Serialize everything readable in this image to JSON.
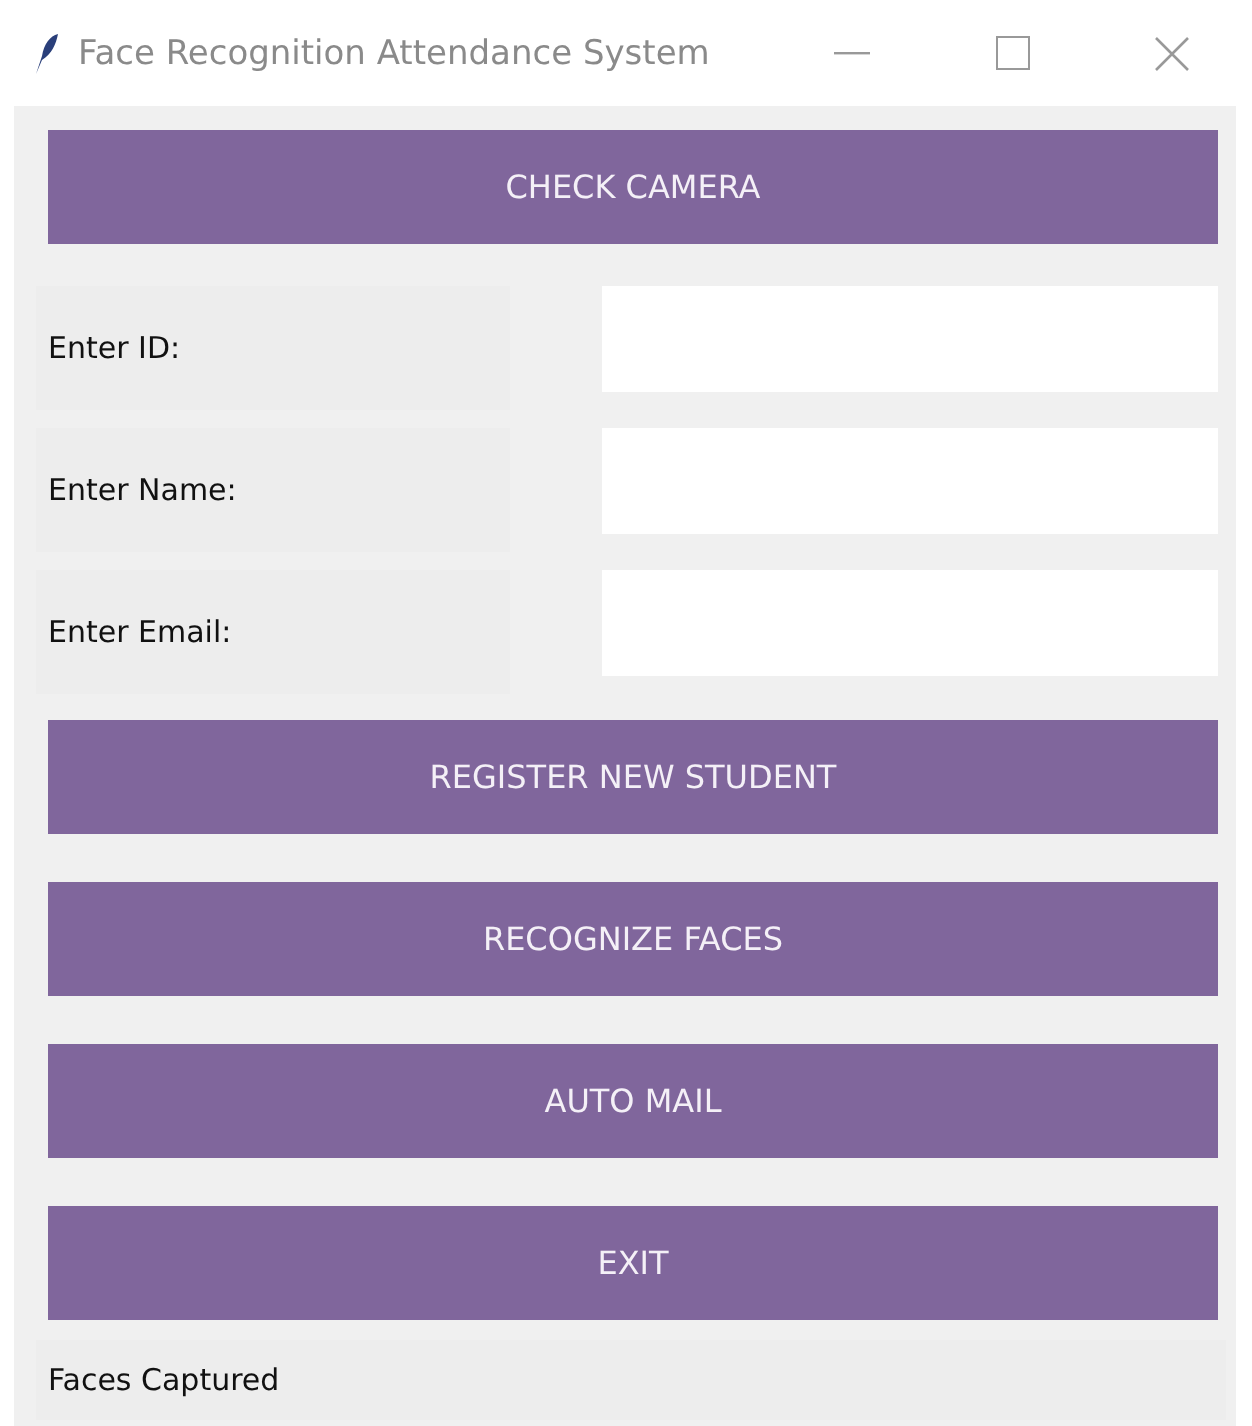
{
  "window": {
    "title": "Face Recognition Attendance System"
  },
  "top_button": "CHECK CAMERA",
  "fields": [
    {
      "label": "Enter ID:"
    },
    {
      "label": "Enter Name:"
    },
    {
      "label": "Enter Email:"
    }
  ],
  "buttons": [
    "REGISTER NEW STUDENT",
    "RECOGNIZE FACES",
    "AUTO MAIL",
    "EXIT"
  ],
  "status_bar": "Faces Captured"
}
